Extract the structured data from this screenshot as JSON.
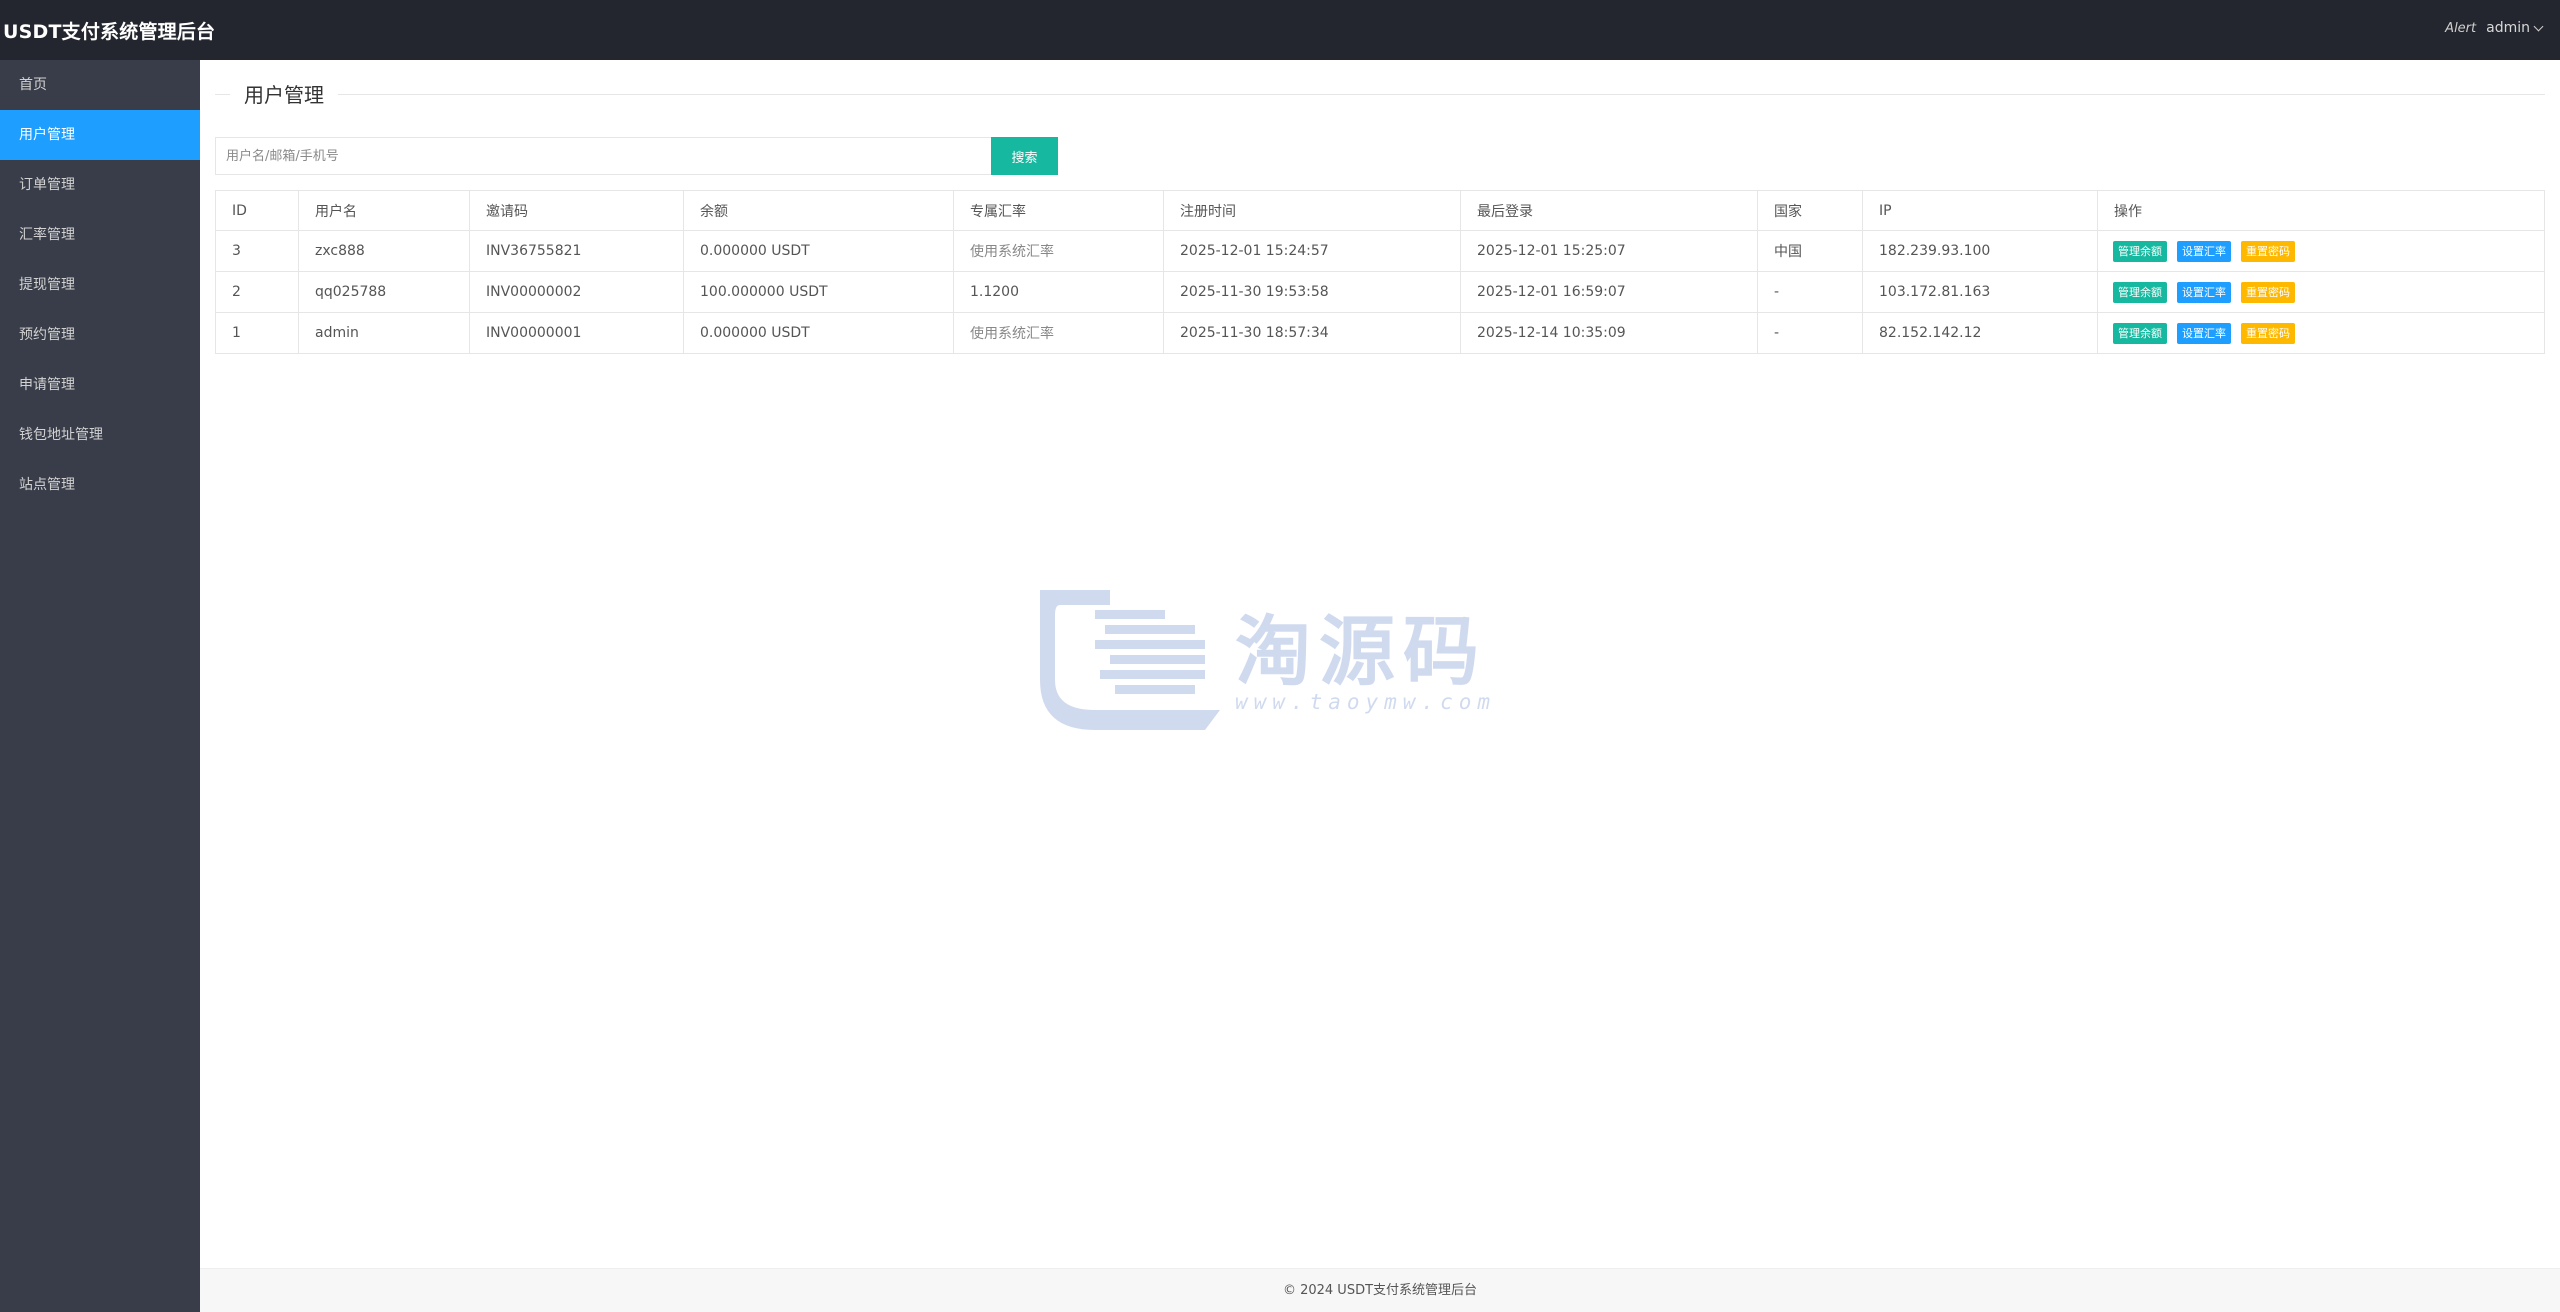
{
  "app": {
    "title": "USDT支付系统管理后台"
  },
  "topbar": {
    "alert": "Alert",
    "user": "admin"
  },
  "sidebar": {
    "items": [
      {
        "label": "首页"
      },
      {
        "label": "用户管理"
      },
      {
        "label": "订单管理"
      },
      {
        "label": "汇率管理"
      },
      {
        "label": "提现管理"
      },
      {
        "label": "预约管理"
      },
      {
        "label": "申请管理"
      },
      {
        "label": "钱包地址管理"
      },
      {
        "label": "站点管理"
      }
    ],
    "active_index": 1
  },
  "page": {
    "title": "用户管理"
  },
  "search": {
    "placeholder": "用户名/邮箱/手机号",
    "value": "",
    "button": "搜索"
  },
  "table": {
    "headers": [
      "ID",
      "用户名",
      "邀请码",
      "余额",
      "专属汇率",
      "注册时间",
      "最后登录",
      "国家",
      "IP",
      "操作"
    ],
    "rows": [
      {
        "id": "3",
        "username": "zxc888",
        "invite": "INV36755821",
        "balance": "0.000000 USDT",
        "rate": "使用系统汇率",
        "registered": "2025-12-01 15:24:57",
        "last_login": "2025-12-01 15:25:07",
        "country": "中国",
        "ip": "182.239.93.100"
      },
      {
        "id": "2",
        "username": "qq025788",
        "invite": "INV00000002",
        "balance": "100.000000 USDT",
        "rate": "1.1200",
        "registered": "2025-11-30 19:53:58",
        "last_login": "2025-12-01 16:59:07",
        "country": "-",
        "ip": "103.172.81.163"
      },
      {
        "id": "1",
        "username": "admin",
        "invite": "INV00000001",
        "balance": "0.000000 USDT",
        "rate": "使用系统汇率",
        "registered": "2025-11-30 18:57:34",
        "last_login": "2025-12-14 10:35:09",
        "country": "-",
        "ip": "82.152.142.12"
      }
    ],
    "actions": {
      "balance": "管理余额",
      "rate": "设置汇率",
      "reset": "重置密码"
    }
  },
  "watermark": {
    "text": "淘源码",
    "url": "www.taoymw.com"
  },
  "footer": {
    "text": "© 2024 USDT支付系统管理后台"
  },
  "colors": {
    "topbar": "#23262e",
    "sidebar": "#393d49",
    "active": "#1e9fff",
    "green": "#16b89f",
    "blue": "#1e9fff",
    "yellow": "#ffb800"
  }
}
